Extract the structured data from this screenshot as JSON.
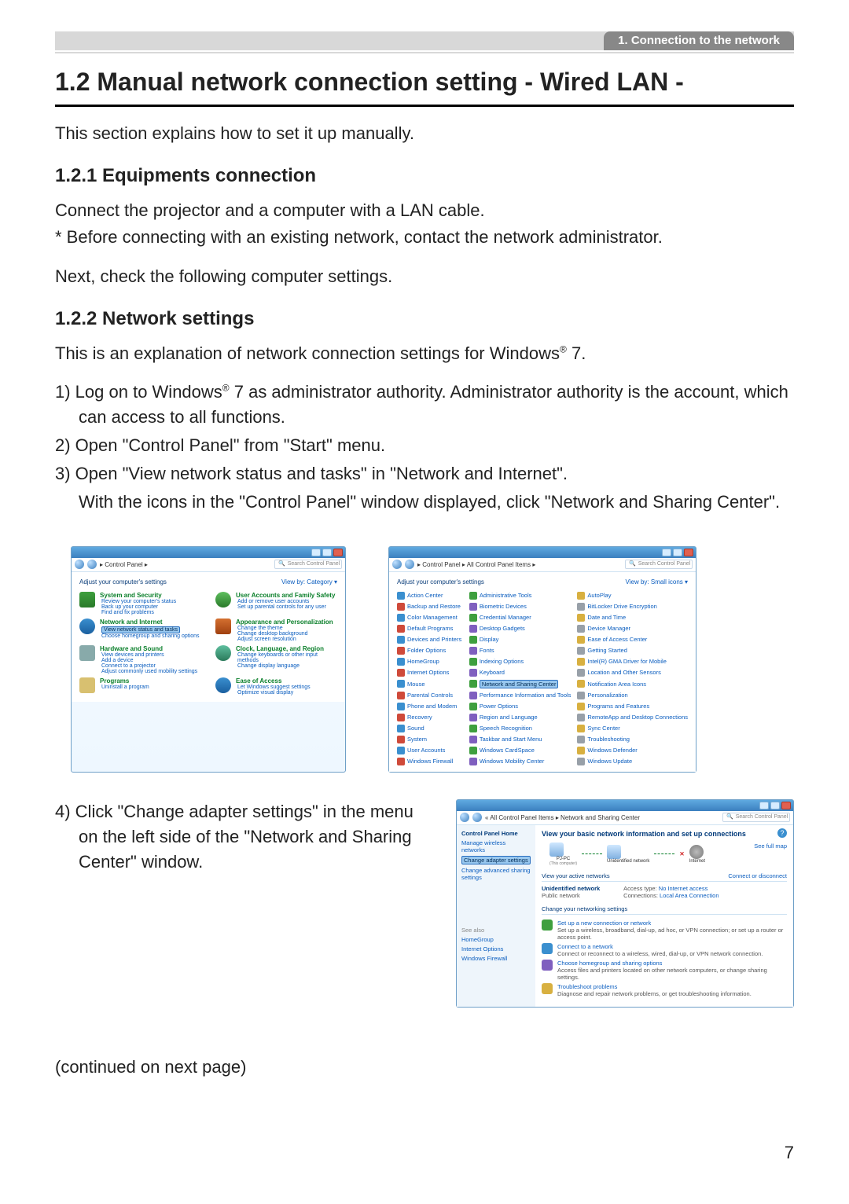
{
  "header_tab": "1. Connection to the network",
  "section_title": "1.2 Manual network connection setting - Wired LAN -",
  "intro_text": "This section explains how to set it up manually.",
  "sub121_title": "1.2.1 Equipments connection",
  "sub121_p1": "Connect the projector and a computer with a LAN cable.",
  "sub121_p2": "* Before connecting with an existing network, contact the network administrator.",
  "sub121_p3": "Next, check the following computer settings.",
  "sub122_title": "1.2.2 Network settings",
  "sub122_intro_prefix": "This is an explanation of network connection settings for Windows",
  "sub122_intro_suffix": " 7.",
  "reg_mark": "®",
  "steps": {
    "s1_prefix": "1) Log on to Windows",
    "s1_suffix": " 7 as administrator authority. Administrator authority is the account, which can access to all functions.",
    "s2": "2) Open \"Control Panel\" from \"Start\" menu.",
    "s3a": "3) Open \"View network status and tasks\" in \"Network and Internet\".",
    "s3b": "With the icons in the \"Control Panel\" window displayed, click \"Network and Sharing Center\".",
    "s4": "4) Click \"Change adapter settings\" in the menu on the left side of the \"Network and Sharing Center\" window."
  },
  "continued": "(continued on next page)",
  "page_number": "7",
  "cp_cat": {
    "breadcrumb": "▸ Control Panel ▸",
    "search": "Search Control Panel",
    "adjust": "Adjust your computer's settings",
    "viewby": "View by:  Category ▾",
    "items": [
      {
        "title": "System and Security",
        "links": [
          "Review your computer's status",
          "Back up your computer",
          "Find and fix problems"
        ],
        "ico": "shield"
      },
      {
        "title": "User Accounts and Family Safety",
        "links": [
          "Add or remove user accounts",
          "Set up parental controls for any user"
        ],
        "ico": "user"
      },
      {
        "title": "Network and Internet",
        "links": [
          "View network status and tasks",
          "Choose homegroup and sharing options"
        ],
        "ico": "net",
        "highlight_link": 0
      },
      {
        "title": "Appearance and Personalization",
        "links": [
          "Change the theme",
          "Change desktop background",
          "Adjust screen resolution"
        ],
        "ico": "appr"
      },
      {
        "title": "Hardware and Sound",
        "links": [
          "View devices and printers",
          "Add a device",
          "Connect to a projector",
          "Adjust commonly used mobility settings"
        ],
        "ico": "hw"
      },
      {
        "title": "Clock, Language, and Region",
        "links": [
          "Change keyboards or other input methods",
          "Change display language"
        ],
        "ico": "clock"
      },
      {
        "title": "Programs",
        "links": [
          "Uninstall a program"
        ],
        "ico": "prog"
      },
      {
        "title": "Ease of Access",
        "links": [
          "Let Windows suggest settings",
          "Optimize visual display"
        ],
        "ico": "ease"
      }
    ]
  },
  "cp_all": {
    "breadcrumb": "▸ Control Panel ▸ All Control Panel Items ▸",
    "search": "Search Control Panel",
    "adjust": "Adjust your computer's settings",
    "viewby": "View by:  Small icons ▾",
    "highlighted": "Network and Sharing Center",
    "items": [
      "Action Center",
      "Administrative Tools",
      "AutoPlay",
      "Backup and Restore",
      "Biometric Devices",
      "BitLocker Drive Encryption",
      "Color Management",
      "Credential Manager",
      "Date and Time",
      "Default Programs",
      "Desktop Gadgets",
      "Device Manager",
      "Devices and Printers",
      "Display",
      "Ease of Access Center",
      "Folder Options",
      "Fonts",
      "Getting Started",
      "HomeGroup",
      "Indexing Options",
      "Intel(R) GMA Driver for Mobile",
      "Internet Options",
      "Keyboard",
      "Location and Other Sensors",
      "Mouse",
      "Network and Sharing Center",
      "Notification Area Icons",
      "Parental Controls",
      "Performance Information and Tools",
      "Personalization",
      "Phone and Modem",
      "Power Options",
      "Programs and Features",
      "Recovery",
      "Region and Language",
      "RemoteApp and Desktop Connections",
      "Sound",
      "Speech Recognition",
      "Sync Center",
      "System",
      "Taskbar and Start Menu",
      "Troubleshooting",
      "User Accounts",
      "Windows CardSpace",
      "Windows Defender",
      "Windows Firewall",
      "Windows Mobility Center",
      "Windows Update"
    ]
  },
  "nsc": {
    "breadcrumb": "« All Control Panel Items ▸ Network and Sharing Center",
    "search": "Search Control Panel",
    "side": {
      "home": "Control Panel Home",
      "links": [
        "Manage wireless networks",
        "Change adapter settings",
        "Change advanced sharing settings"
      ],
      "highlight_index": 1,
      "seealso_hdr": "See also",
      "seealso": [
        "HomeGroup",
        "Internet Options",
        "Windows Firewall"
      ]
    },
    "main": {
      "heading": "View your basic network information and set up connections",
      "full_map": "See full map",
      "map_labels": {
        "pc": "PJ-PC",
        "pc_sub": "(This computer)",
        "net": "Unidentified network",
        "internet": "Internet"
      },
      "active_hdr": "View your active networks",
      "conn_disc": "Connect or disconnect",
      "net_name": "Unidentified network",
      "net_type": "Public network",
      "access_lbl": "Access type:",
      "access_val": "No Internet access",
      "conn_lbl": "Connections:",
      "conn_val": "Local Area Connection",
      "change_hdr": "Change your networking settings",
      "tasks": [
        {
          "title": "Set up a new connection or network",
          "desc": "Set up a wireless, broadband, dial-up, ad hoc, or VPN connection; or set up a router or access point."
        },
        {
          "title": "Connect to a network",
          "desc": "Connect or reconnect to a wireless, wired, dial-up, or VPN network connection."
        },
        {
          "title": "Choose homegroup and sharing options",
          "desc": "Access files and printers located on other network computers, or change sharing settings."
        },
        {
          "title": "Troubleshoot problems",
          "desc": "Diagnose and repair network problems, or get troubleshooting information."
        }
      ]
    }
  }
}
